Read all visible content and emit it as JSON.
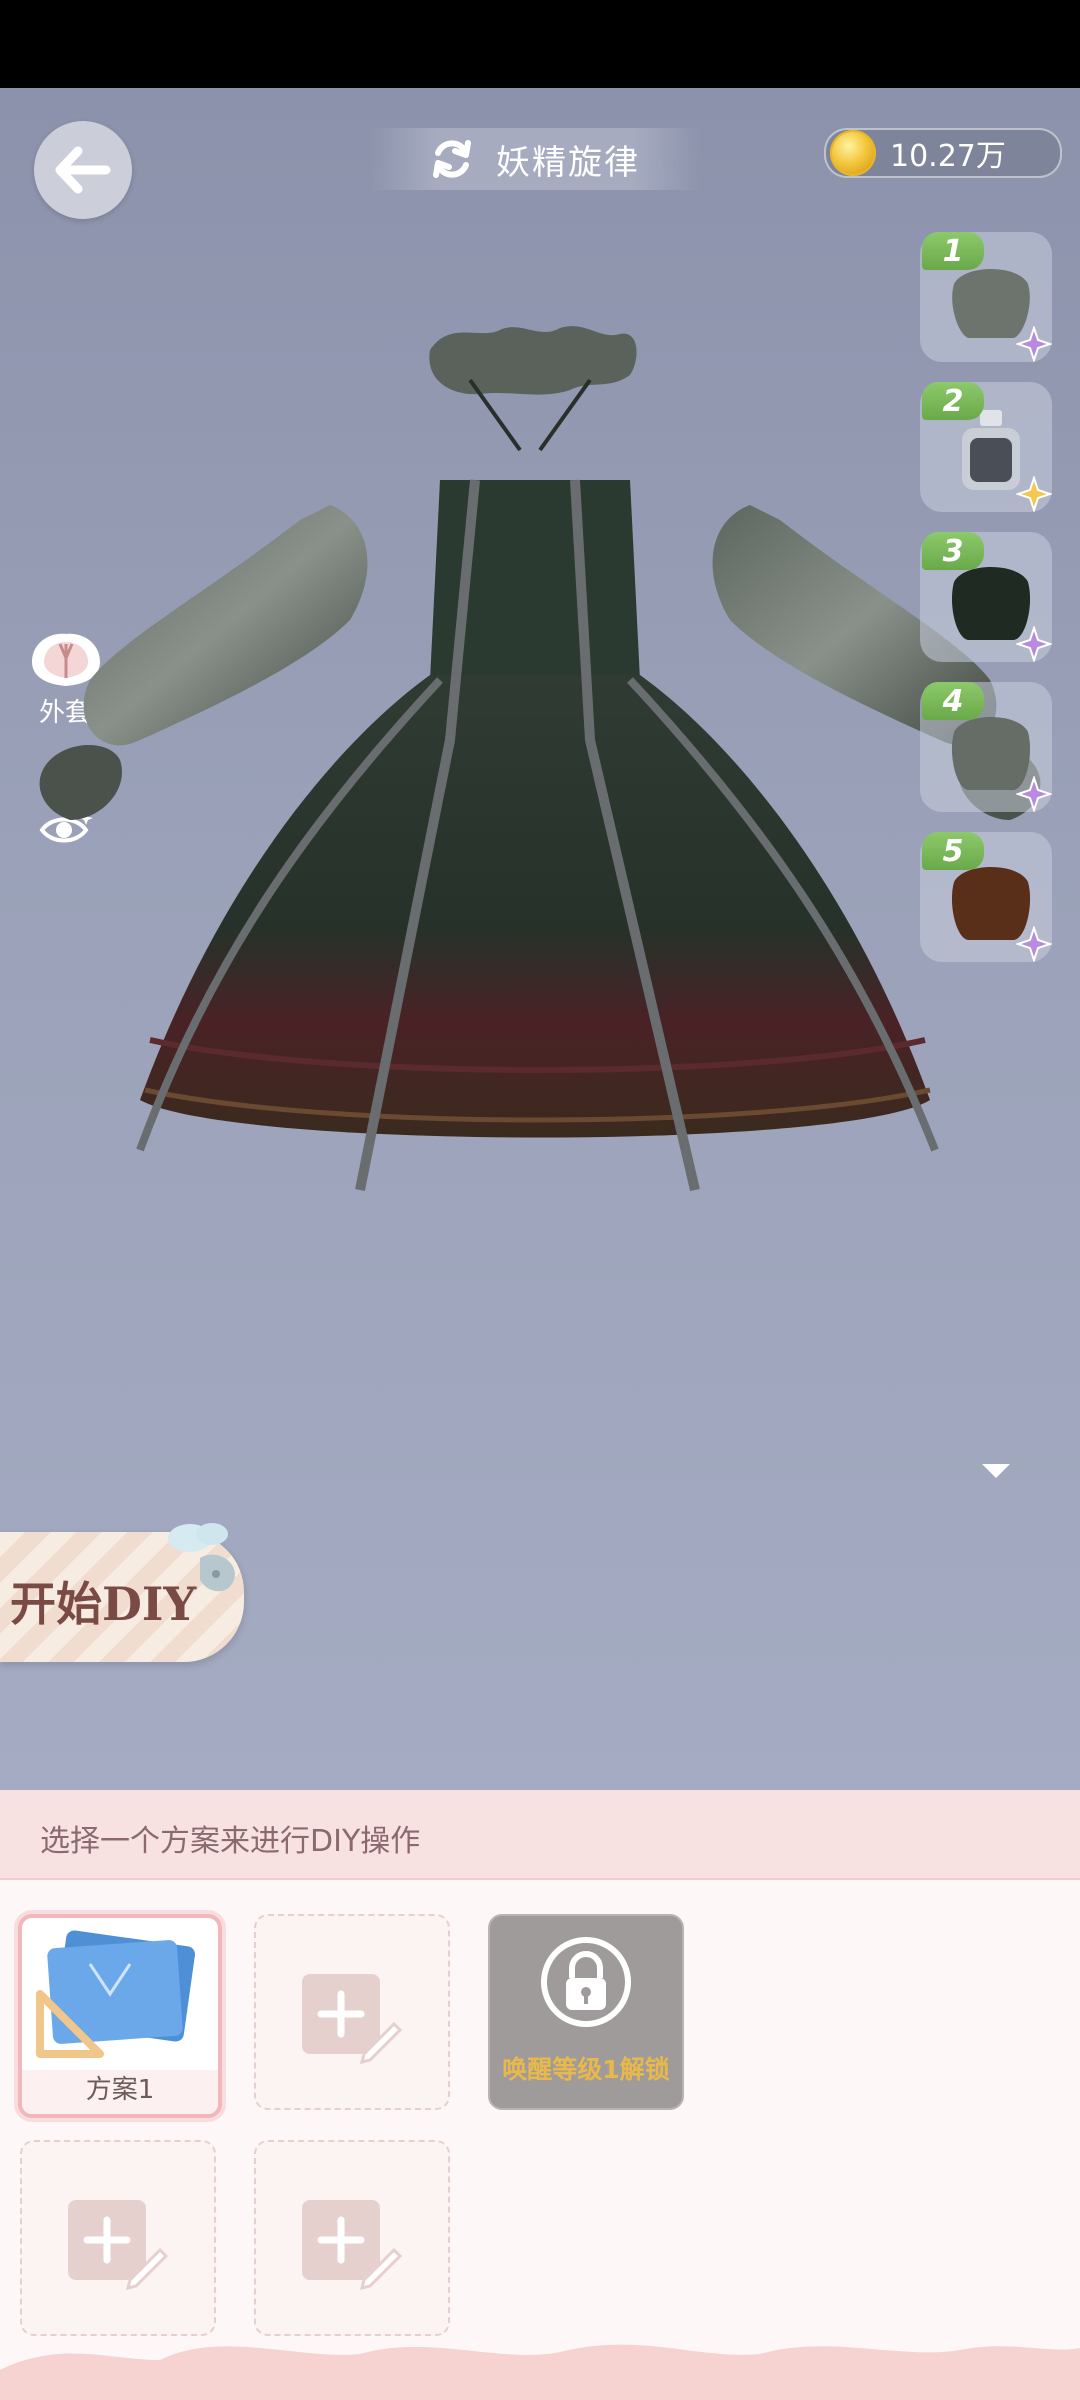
{
  "header": {
    "title": "妖精旋律",
    "coins": "10.27万"
  },
  "side_menu": {
    "coat_label": "外套"
  },
  "slots": [
    {
      "number": "1",
      "item": "dark-green-ruffle-collar",
      "badge": "purple-flower"
    },
    {
      "number": "2",
      "item": "perfume-bottle",
      "badge": "gold-flower"
    },
    {
      "number": "3",
      "item": "dark-green-dress",
      "badge": "purple-flower"
    },
    {
      "number": "4",
      "item": "green-sleeves",
      "badge": "purple-flower"
    },
    {
      "number": "5",
      "item": "brown-skirt",
      "badge": "purple-flower"
    }
  ],
  "diy": {
    "start_label": "开始DIY"
  },
  "plans": {
    "instruction": "选择一个方案来进行DIY操作",
    "items": [
      {
        "label": "方案1",
        "state": "selected"
      },
      {
        "label": "",
        "state": "empty"
      },
      {
        "label": "唤醒等级1解锁",
        "state": "locked"
      },
      {
        "label": "",
        "state": "empty"
      },
      {
        "label": "",
        "state": "empty"
      }
    ]
  },
  "colors": {
    "accent_green": "#6aa94a",
    "panel_pink": "#f8e1e1",
    "lock_gold": "#e8b84a",
    "diy_text": "#7a4a45"
  }
}
